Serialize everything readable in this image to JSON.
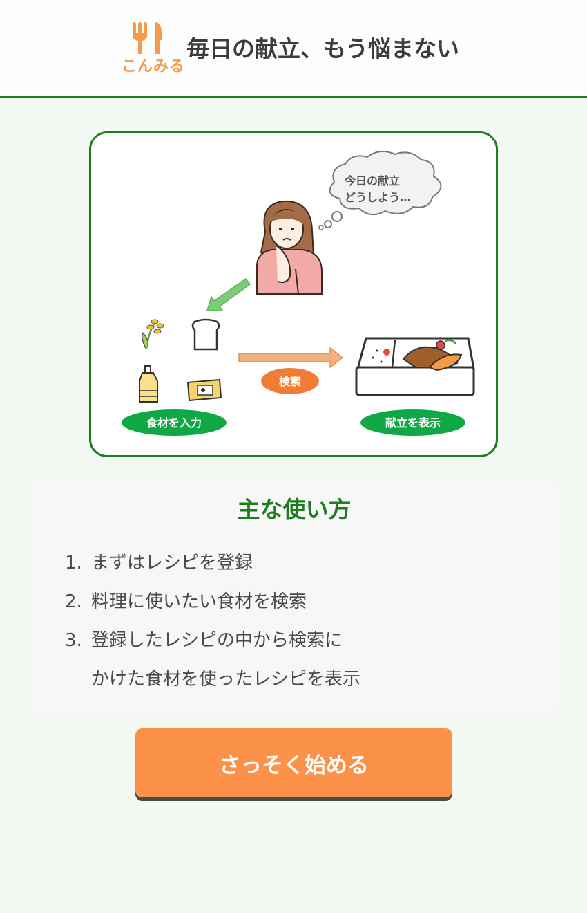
{
  "header": {
    "logo_text": "こんみる",
    "tagline": "毎日の献立、もう悩まない"
  },
  "illustration": {
    "thought_bubble_line1": "今日の献立",
    "thought_bubble_line2": "どうしよう…",
    "search_label": "検索",
    "input_label": "食材を入力",
    "output_label": "献立を表示"
  },
  "howto": {
    "title": "主な使い方",
    "steps": [
      {
        "num": "1.",
        "text": "まずはレシピを登録"
      },
      {
        "num": "2.",
        "text": "料理に使いたい食材を検索"
      },
      {
        "num": "3.",
        "text": "登録したレシピの中から検索に\nかけた食材を使ったレシピを表示"
      }
    ]
  },
  "cta": {
    "label": "さっそく始める"
  },
  "colors": {
    "brand_orange": "#fc924a",
    "brand_green": "#1e7d1e",
    "pill_green": "#0fa844",
    "search_orange": "#f07d35"
  }
}
